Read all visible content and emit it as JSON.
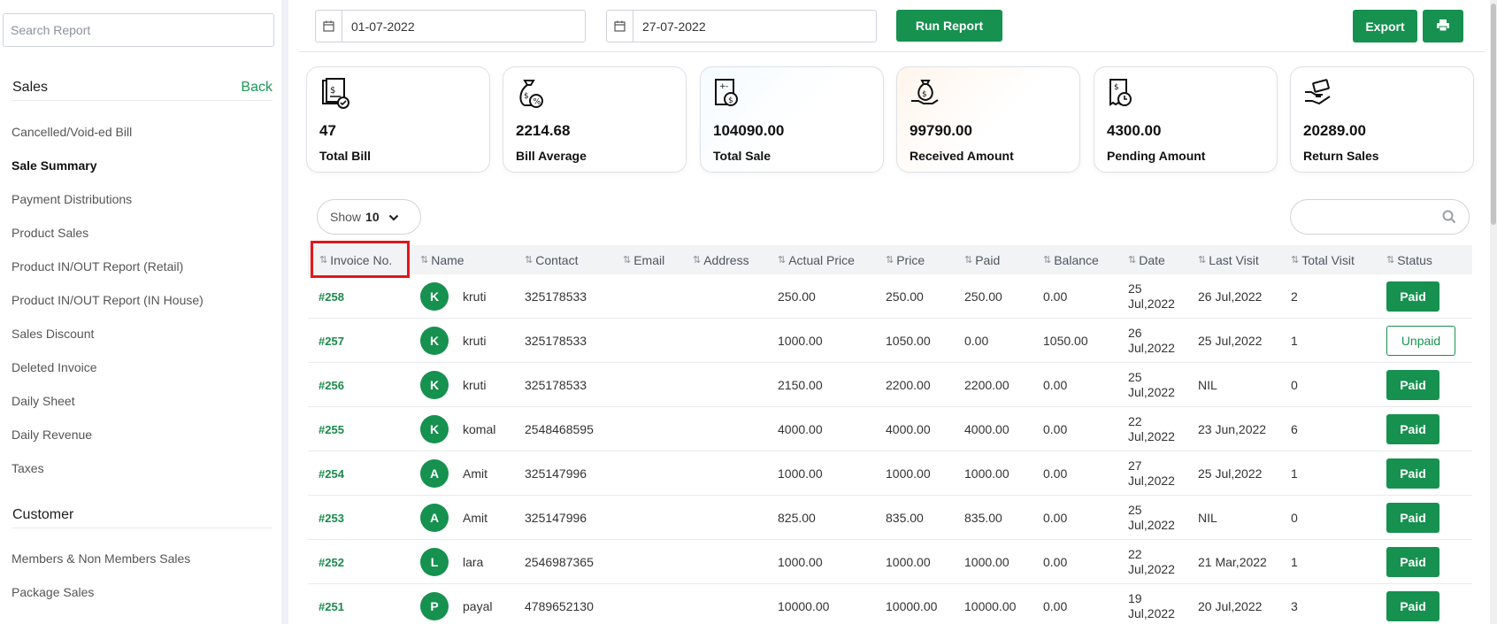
{
  "sidebar": {
    "search_placeholder": "Search Report",
    "sales_title": "Sales",
    "back_label": "Back",
    "sales_items": [
      {
        "label": "Cancelled/Void-ed Bill"
      },
      {
        "label": "Sale Summary",
        "active": true
      },
      {
        "label": "Payment Distributions"
      },
      {
        "label": "Product Sales"
      },
      {
        "label": "Product IN/OUT Report (Retail)"
      },
      {
        "label": "Product IN/OUT Report (IN House)"
      },
      {
        "label": "Sales Discount"
      },
      {
        "label": "Deleted Invoice"
      },
      {
        "label": "Daily Sheet"
      },
      {
        "label": "Daily Revenue"
      },
      {
        "label": "Taxes"
      }
    ],
    "customer_title": "Customer",
    "customer_items": [
      {
        "label": "Members & Non Members Sales"
      },
      {
        "label": "Package Sales"
      }
    ]
  },
  "toolbar": {
    "from_date": "01-07-2022",
    "to_date": "27-07-2022",
    "run_report_label": "Run Report",
    "export_label": "Export",
    "print_icon": "printer-icon"
  },
  "cards": [
    {
      "value": "47",
      "label": "Total Bill",
      "icon": "bill-icon"
    },
    {
      "value": "2214.68",
      "label": "Bill Average",
      "icon": "money-bag-percent-icon"
    },
    {
      "value": "104090.00",
      "label": "Total Sale",
      "icon": "calculator-receipt-icon"
    },
    {
      "value": "99790.00",
      "label": "Received Amount",
      "icon": "money-bag-hand-icon"
    },
    {
      "value": "4300.00",
      "label": "Pending Amount",
      "icon": "receipt-clock-icon"
    },
    {
      "value": "20289.00",
      "label": "Return Sales",
      "icon": "hand-money-icon"
    }
  ],
  "table_controls": {
    "show_label": "Show",
    "show_value": "10"
  },
  "table": {
    "columns": [
      "Invoice No.",
      "Name",
      "Contact",
      "Email",
      "Address",
      "Actual Price",
      "Price",
      "Paid",
      "Balance",
      "Date",
      "Last Visit",
      "Total Visit",
      "Status"
    ],
    "rows": [
      {
        "invoice": "#258",
        "initial": "K",
        "name": "kruti",
        "contact": "325178533",
        "email": "",
        "address": "",
        "actual_price": "250.00",
        "price": "250.00",
        "paid": "250.00",
        "balance": "0.00",
        "date_day": "25",
        "date_rest": "Jul,2022",
        "last_visit": "26 Jul,2022",
        "total_visit": "2",
        "status": "Paid"
      },
      {
        "invoice": "#257",
        "initial": "K",
        "name": "kruti",
        "contact": "325178533",
        "email": "",
        "address": "",
        "actual_price": "1000.00",
        "price": "1050.00",
        "paid": "0.00",
        "balance": "1050.00",
        "date_day": "26",
        "date_rest": "Jul,2022",
        "last_visit": "25 Jul,2022",
        "total_visit": "1",
        "status": "Unpaid"
      },
      {
        "invoice": "#256",
        "initial": "K",
        "name": "kruti",
        "contact": "325178533",
        "email": "",
        "address": "",
        "actual_price": "2150.00",
        "price": "2200.00",
        "paid": "2200.00",
        "balance": "0.00",
        "date_day": "25",
        "date_rest": "Jul,2022",
        "last_visit": "NIL",
        "total_visit": "0",
        "status": "Paid"
      },
      {
        "invoice": "#255",
        "initial": "K",
        "name": "komal",
        "contact": "2548468595",
        "email": "",
        "address": "",
        "actual_price": "4000.00",
        "price": "4000.00",
        "paid": "4000.00",
        "balance": "0.00",
        "date_day": "22",
        "date_rest": "Jul,2022",
        "last_visit": "23 Jun,2022",
        "total_visit": "6",
        "status": "Paid"
      },
      {
        "invoice": "#254",
        "initial": "A",
        "name": "Amit",
        "contact": "325147996",
        "email": "",
        "address": "",
        "actual_price": "1000.00",
        "price": "1000.00",
        "paid": "1000.00",
        "balance": "0.00",
        "date_day": "27",
        "date_rest": "Jul,2022",
        "last_visit": "25 Jul,2022",
        "total_visit": "1",
        "status": "Paid"
      },
      {
        "invoice": "#253",
        "initial": "A",
        "name": "Amit",
        "contact": "325147996",
        "email": "",
        "address": "",
        "actual_price": "825.00",
        "price": "835.00",
        "paid": "835.00",
        "balance": "0.00",
        "date_day": "25",
        "date_rest": "Jul,2022",
        "last_visit": "NIL",
        "total_visit": "0",
        "status": "Paid"
      },
      {
        "invoice": "#252",
        "initial": "L",
        "name": "lara",
        "contact": "2546987365",
        "email": "",
        "address": "",
        "actual_price": "1000.00",
        "price": "1000.00",
        "paid": "1000.00",
        "balance": "0.00",
        "date_day": "22",
        "date_rest": "Jul,2022",
        "last_visit": "21 Mar,2022",
        "total_visit": "1",
        "status": "Paid"
      },
      {
        "invoice": "#251",
        "initial": "P",
        "name": "payal",
        "contact": "4789652130",
        "email": "",
        "address": "",
        "actual_price": "10000.00",
        "price": "10000.00",
        "paid": "10000.00",
        "balance": "0.00",
        "date_day": "19",
        "date_rest": "Jul,2022",
        "last_visit": "20 Jul,2022",
        "total_visit": "3",
        "status": "Paid"
      }
    ]
  },
  "colors": {
    "brand_green": "#16914f",
    "highlight_red": "#e3161b"
  }
}
